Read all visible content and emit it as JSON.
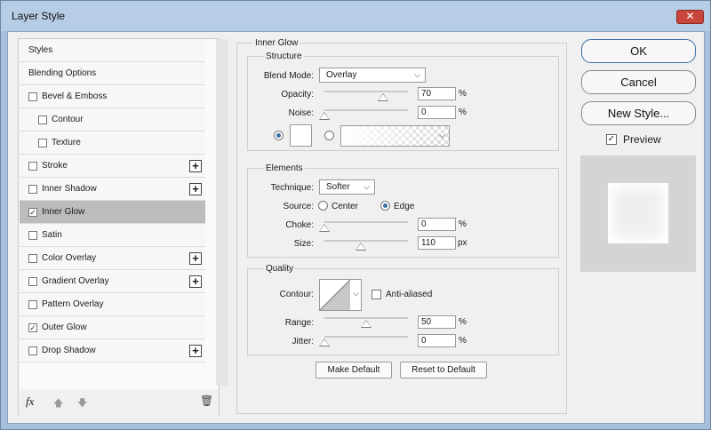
{
  "window": {
    "title": "Layer Style",
    "close": "✕"
  },
  "sidebar": {
    "items": [
      {
        "label": "Styles",
        "check": "none",
        "plus": false,
        "sel": false,
        "indent": 0
      },
      {
        "label": "Blending Options",
        "check": "none",
        "plus": false,
        "sel": false,
        "indent": 0
      },
      {
        "label": "Bevel & Emboss",
        "check": "off",
        "plus": false,
        "sel": false,
        "indent": 0
      },
      {
        "label": "Contour",
        "check": "off",
        "plus": false,
        "sel": false,
        "indent": 1
      },
      {
        "label": "Texture",
        "check": "off",
        "plus": false,
        "sel": false,
        "indent": 1
      },
      {
        "label": "Stroke",
        "check": "off",
        "plus": true,
        "sel": false,
        "indent": 0
      },
      {
        "label": "Inner Shadow",
        "check": "off",
        "plus": true,
        "sel": false,
        "indent": 0
      },
      {
        "label": "Inner Glow",
        "check": "on",
        "plus": false,
        "sel": true,
        "indent": 0
      },
      {
        "label": "Satin",
        "check": "off",
        "plus": false,
        "sel": false,
        "indent": 0
      },
      {
        "label": "Color Overlay",
        "check": "off",
        "plus": true,
        "sel": false,
        "indent": 0
      },
      {
        "label": "Gradient Overlay",
        "check": "off",
        "plus": true,
        "sel": false,
        "indent": 0
      },
      {
        "label": "Pattern Overlay",
        "check": "off",
        "plus": false,
        "sel": false,
        "indent": 0
      },
      {
        "label": "Outer Glow",
        "check": "on",
        "plus": false,
        "sel": false,
        "indent": 0
      },
      {
        "label": "Drop Shadow",
        "check": "off",
        "plus": true,
        "sel": false,
        "indent": 0
      }
    ],
    "fx": "fx",
    "plus_glyph": "+",
    "check_glyph": "✓",
    "up_arrow": "🡅",
    "down_arrow": "🡇",
    "trash": "🗑"
  },
  "inner_glow": {
    "title": "Inner Glow",
    "structure": {
      "title": "Structure",
      "blend_label": "Blend Mode:",
      "blend_value": "Overlay",
      "opacity_label": "Opacity:",
      "opacity_value": "70",
      "opacity_fraction": 0.7,
      "noise_label": "Noise:",
      "noise_value": "0",
      "noise_fraction": 0
    },
    "elements": {
      "title": "Elements",
      "technique_label": "Technique:",
      "technique_value": "Softer",
      "source_label": "Source:",
      "center_label": "Center",
      "edge_label": "Edge",
      "source_selected": "Edge",
      "choke_label": "Choke:",
      "choke_value": "0",
      "choke_fraction": 0,
      "size_label": "Size:",
      "size_value": "110",
      "size_unit": "px",
      "size_fraction": 0.44
    },
    "quality": {
      "title": "Quality",
      "contour_label": "Contour:",
      "antialias_label": "Anti-aliased",
      "range_label": "Range:",
      "range_value": "50",
      "range_fraction": 0.5,
      "jitter_label": "Jitter:",
      "jitter_value": "0",
      "jitter_fraction": 0
    },
    "pct": "%",
    "make_default": "Make Default",
    "reset_default": "Reset to Default",
    "chevron": "⌵"
  },
  "buttons": {
    "ok": "OK",
    "cancel": "Cancel",
    "new_style": "New Style...",
    "preview_label": "Preview",
    "preview_checked": true
  }
}
